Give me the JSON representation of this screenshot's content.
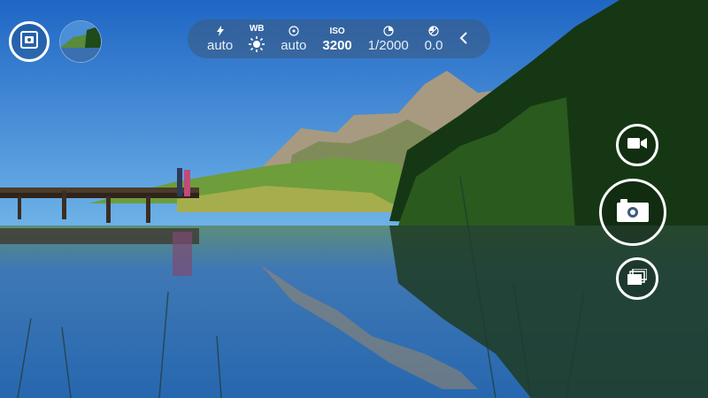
{
  "viewfinder": {
    "scene": "lake-mountain-reflection"
  },
  "top_left": {
    "mode_icon": "camera-lens-icon",
    "last_photo": "gallery-thumbnail"
  },
  "settings_bar": {
    "flash": {
      "icon": "lightning-icon",
      "value": "auto"
    },
    "white_balance": {
      "label": "WB",
      "icon": "sun-icon"
    },
    "focus": {
      "icon": "focus-target-icon",
      "value": "auto"
    },
    "iso": {
      "label": "ISO",
      "value": "3200"
    },
    "shutter_speed": {
      "icon": "shutter-dial-icon",
      "value": "1/2000"
    },
    "exposure": {
      "icon": "exposure-compensation-icon",
      "value": "0.0"
    },
    "collapse_icon": "chevron-left-icon"
  },
  "right_controls": {
    "video_icon": "video-camera-icon",
    "shutter_icon": "camera-icon",
    "burst_icon": "burst-photos-icon"
  },
  "colors": {
    "ui_white": "#ffffff",
    "bar_background": "#3c5a7d"
  }
}
